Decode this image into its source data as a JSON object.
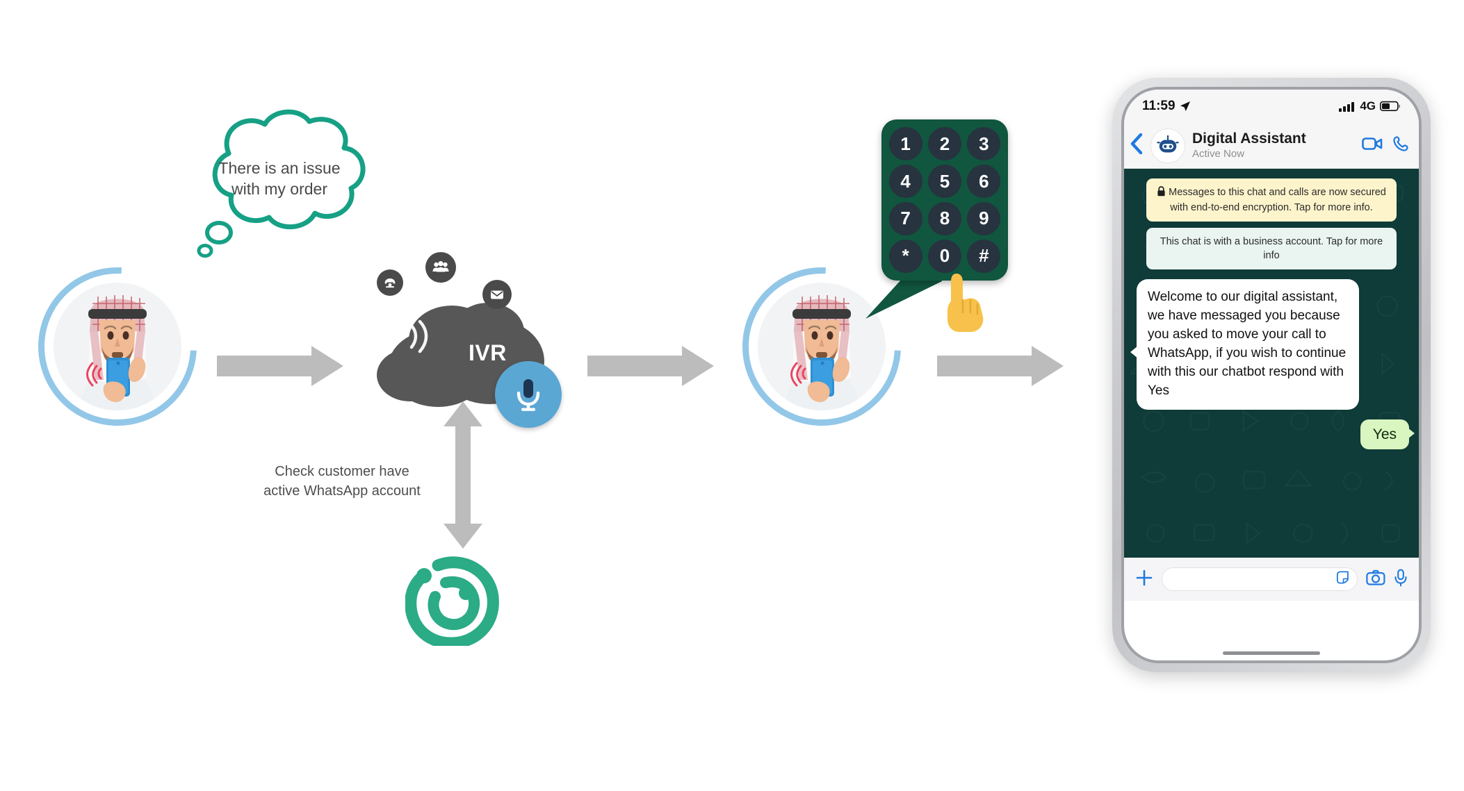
{
  "flow": {
    "thought": {
      "line1": "There is an issue",
      "line2": "with my order",
      "text": "There is an issue with my order"
    },
    "ivr": {
      "label": "IVR",
      "icons": [
        "telephone-icon",
        "people-group-icon",
        "envelope-icon"
      ]
    },
    "mic_icon": "microphone-icon",
    "caption": {
      "line1": "Check customer have",
      "line2": "active WhatsApp account",
      "text": "Check customer have active WhatsApp account"
    },
    "logo_name": "teal-swirl-logo",
    "avatars": [
      {
        "name": "customer-avatar-thinking",
        "alt": "Man in keffiyeh holding phone"
      },
      {
        "name": "customer-avatar-keypad",
        "alt": "Man in keffiyeh holding phone"
      }
    ],
    "arrows": [
      "arrow-right-1",
      "arrow-right-2",
      "arrow-right-3",
      "arrow-updown"
    ]
  },
  "keypad": {
    "keys": [
      "1",
      "2",
      "3",
      "4",
      "5",
      "6",
      "7",
      "8",
      "9",
      "*",
      "0",
      "#"
    ],
    "pressed": "0",
    "bg_color": "#11563f",
    "key_color": "#27333f"
  },
  "phone": {
    "status_bar": {
      "time": "11:59",
      "location_icon": "location-arrow-icon",
      "signal_icon": "signal-bars-icon",
      "network": "4G",
      "battery_icon": "battery-icon"
    },
    "header": {
      "back_icon": "back-chevron-icon",
      "avatar_icon": "bot-avatar-icon",
      "title": "Digital Assistant",
      "subtitle": "Active Now",
      "video_icon": "video-call-icon",
      "call_icon": "voice-call-icon"
    },
    "system_notices": [
      {
        "lock_icon": "lock-icon",
        "text": "Messages to this chat and calls are now secured with end-to-end encryption. Tap for more info."
      },
      {
        "text": "This chat is with a business account. Tap for more info"
      }
    ],
    "messages": [
      {
        "from": "bot",
        "text": "Welcome to our digital assistant, we have messaged you because you asked to move your call to WhatsApp, if you wish to continue with this our chatbot respond with Yes"
      },
      {
        "from": "user",
        "text": "Yes"
      }
    ],
    "input_bar": {
      "plus_icon": "plus-icon",
      "placeholder": "",
      "value": "",
      "sticker_icon": "sticker-icon",
      "camera_icon": "camera-icon",
      "mic_icon": "microphone-icon"
    }
  },
  "colors": {
    "teal": "#16a085",
    "avatar_ring": "#92c7e8",
    "arrow_gray": "#bcbcbc",
    "chat_bg": "#0f3b38",
    "keypad_green": "#11563f",
    "outgoing_bubble": "#d9f5c0",
    "whatsapp_accent": "#1f7ae0"
  }
}
